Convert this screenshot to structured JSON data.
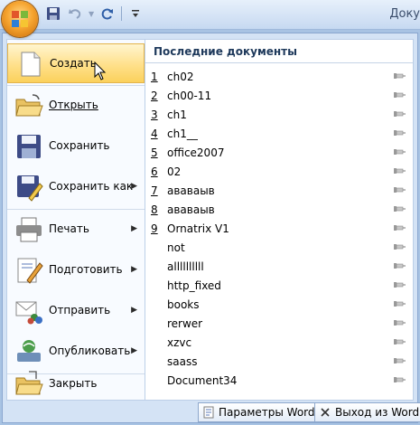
{
  "window": {
    "title": "Доку"
  },
  "quick_access": {
    "icons": [
      "save-icon",
      "undo-icon",
      "redo-icon",
      "customize-icon"
    ]
  },
  "commands": [
    {
      "label": "Создать",
      "icon": "new-document-icon",
      "has_submenu": false,
      "active": true
    },
    {
      "label": "Открыть",
      "icon": "open-folder-icon",
      "has_submenu": false,
      "active": false
    },
    {
      "label": "Сохранить",
      "icon": "save-icon",
      "has_submenu": false,
      "active": false
    },
    {
      "label": "Сохранить как",
      "icon": "save-as-icon",
      "has_submenu": true,
      "active": false
    },
    {
      "label": "Печать",
      "icon": "printer-icon",
      "has_submenu": true,
      "active": false
    },
    {
      "label": "Подготовить",
      "icon": "prepare-icon",
      "has_submenu": true,
      "active": false
    },
    {
      "label": "Отправить",
      "icon": "send-icon",
      "has_submenu": true,
      "active": false
    },
    {
      "label": "Опубликовать",
      "icon": "publish-icon",
      "has_submenu": true,
      "active": false
    },
    {
      "label": "Закрыть",
      "icon": "close-document-icon",
      "has_submenu": false,
      "active": false
    }
  ],
  "recent": {
    "header": "Последние документы",
    "items": [
      {
        "num": "1",
        "name": "ch02"
      },
      {
        "num": "2",
        "name": "ch00-11"
      },
      {
        "num": "3",
        "name": "ch1"
      },
      {
        "num": "4",
        "name": "ch1__"
      },
      {
        "num": "5",
        "name": "office2007"
      },
      {
        "num": "6",
        "name": "02"
      },
      {
        "num": "7",
        "name": "ававаыв"
      },
      {
        "num": "8",
        "name": "ававаыв"
      },
      {
        "num": "9",
        "name": "Ornatrix V1"
      },
      {
        "num": "",
        "name": "not"
      },
      {
        "num": "",
        "name": "allllllllll"
      },
      {
        "num": "",
        "name": "http_fixed"
      },
      {
        "num": "",
        "name": "books"
      },
      {
        "num": "",
        "name": "rerwer"
      },
      {
        "num": "",
        "name": "xzvc"
      },
      {
        "num": "",
        "name": "saass"
      },
      {
        "num": "",
        "name": "Document34"
      }
    ]
  },
  "buttons": {
    "options": "Параметры Word",
    "exit": "Выход из Word"
  },
  "colors": {
    "accent": "#f6a531",
    "highlight": "#ffe08a",
    "panel": "#d4e3f5"
  }
}
